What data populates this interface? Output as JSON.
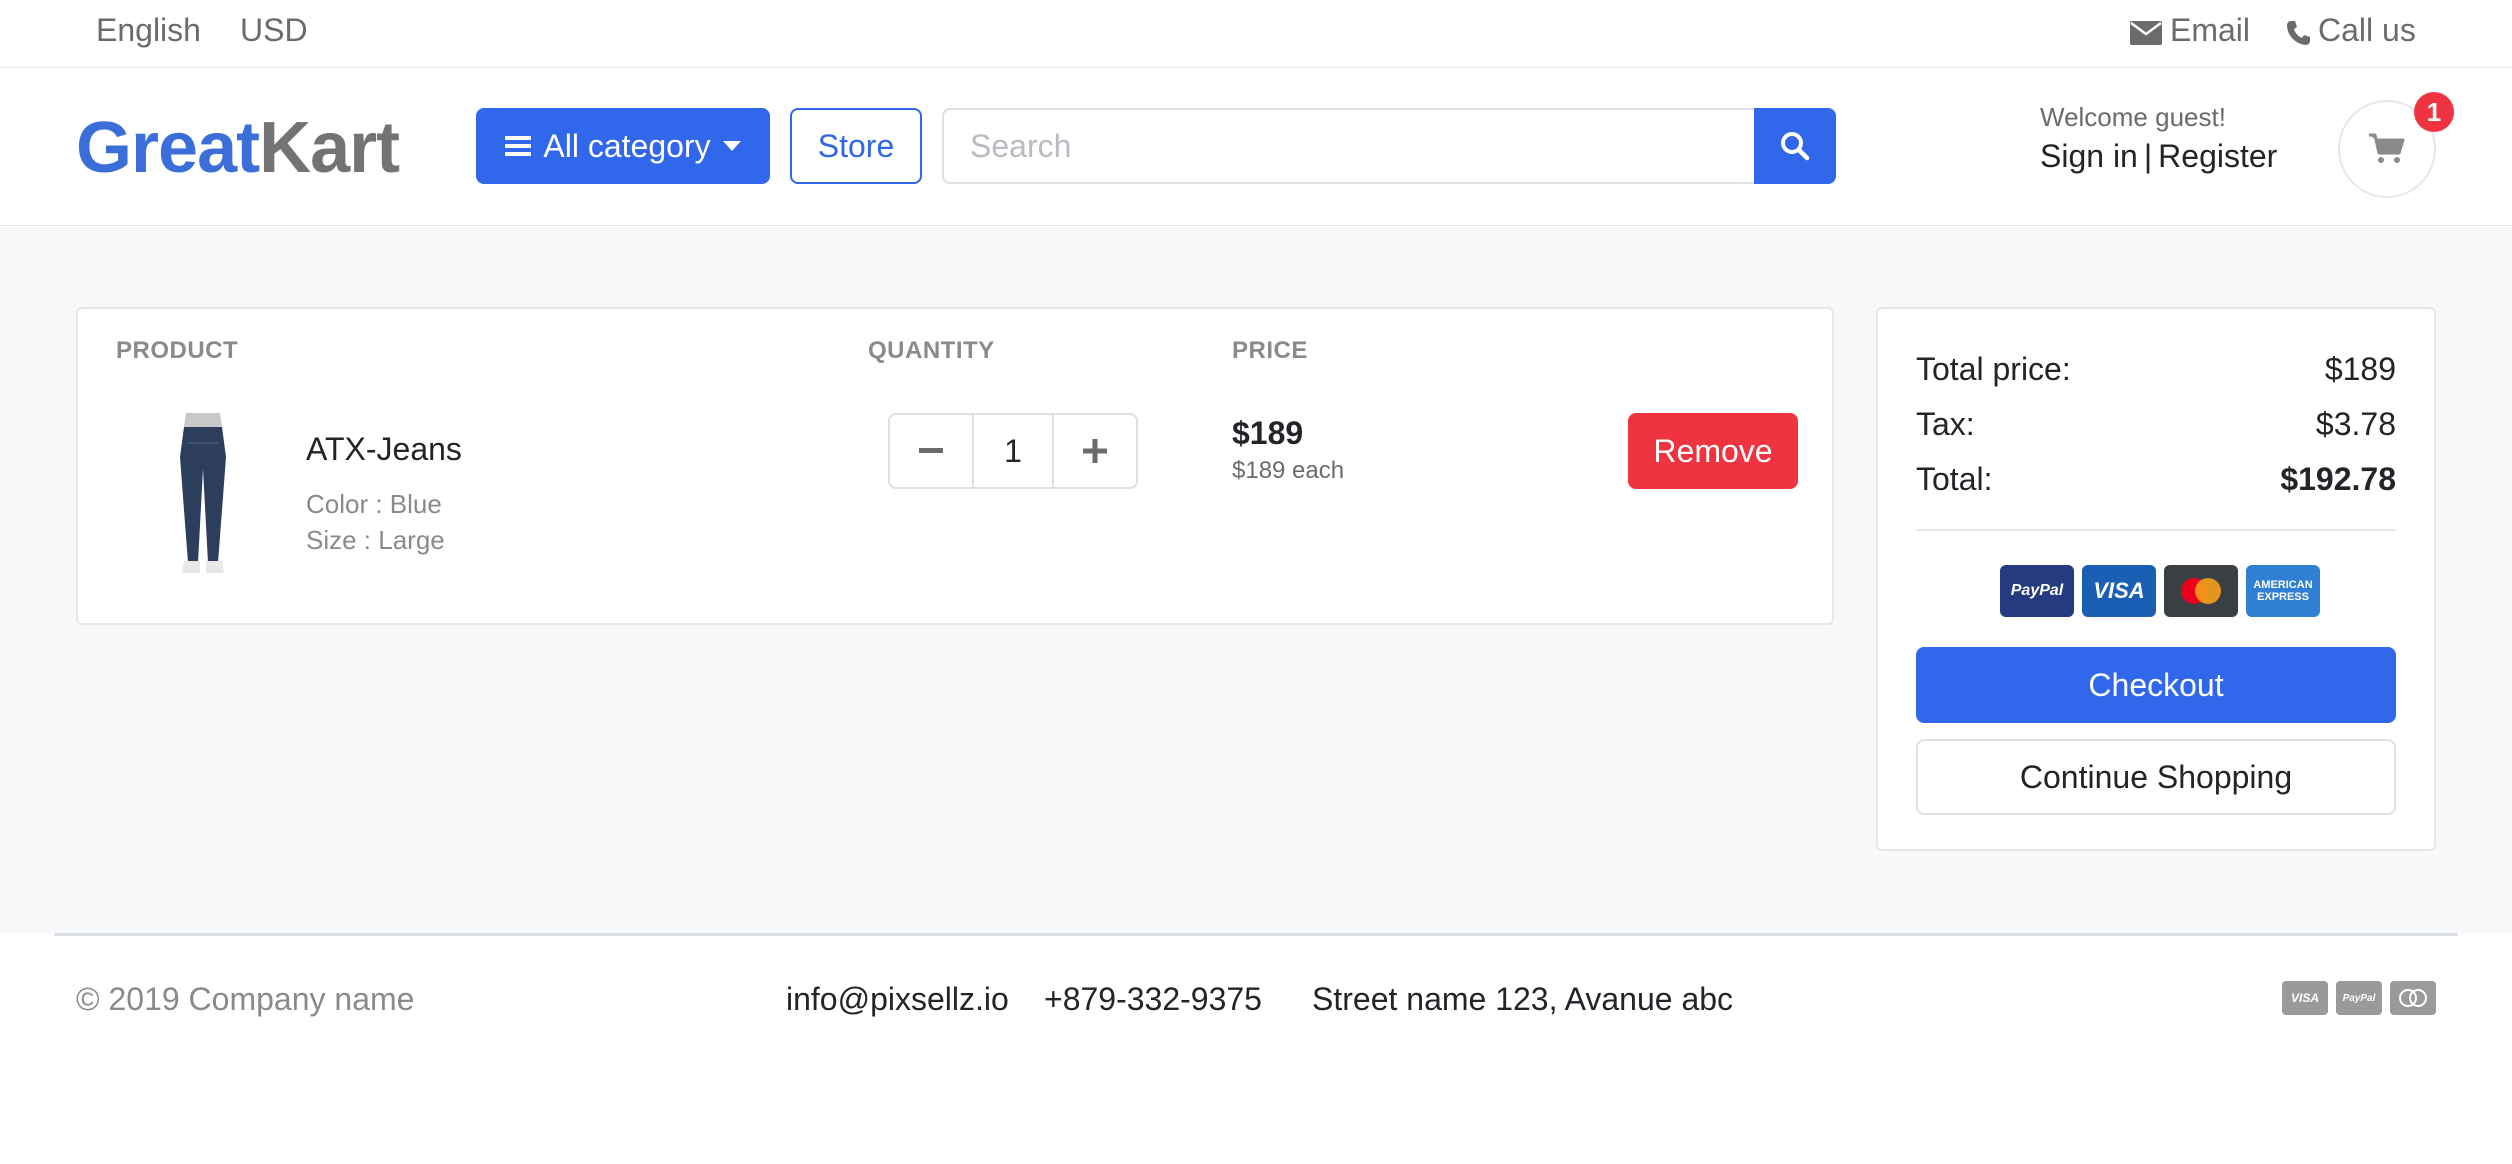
{
  "topbar": {
    "language": "English",
    "currency": "USD",
    "email_label": "Email",
    "call_label": "Call us"
  },
  "header": {
    "logo_part1": "Great",
    "logo_part2": "Kart",
    "category_label": "All category",
    "store_label": "Store",
    "search_placeholder": "Search",
    "welcome": "Welcome guest!",
    "sign_in": "Sign in",
    "separator": "|",
    "register": "Register",
    "cart_count": "1"
  },
  "cart": {
    "columns": {
      "product": "PRODUCT",
      "quantity": "QUANTITY",
      "price": "PRICE"
    },
    "items": [
      {
        "name": "ATX-Jeans",
        "color": "Color : Blue",
        "size": "Size : Large",
        "quantity": "1",
        "price": "$189",
        "price_each": "$189 each",
        "remove_label": "Remove"
      }
    ]
  },
  "summary": {
    "total_price_label": "Total price:",
    "total_price_value": "$189",
    "tax_label": "Tax:",
    "tax_value": "$3.78",
    "total_label": "Total:",
    "total_value": "$192.78",
    "payment_methods": [
      "PayPal",
      "VISA",
      "MasterCard",
      "AMERICAN EXPRESS"
    ],
    "checkout_label": "Checkout",
    "continue_label": "Continue Shopping"
  },
  "footer": {
    "copyright": "© 2019 Company name",
    "email": "info@pixsellz.io",
    "phone": "+879-332-9375",
    "address": "Street name 123, Avanue abc",
    "payment_icons": [
      "VISA",
      "PayPal",
      "MasterCard"
    ]
  },
  "colors": {
    "primary": "#3167eb",
    "danger": "#ef3340",
    "logo_blue": "#3b6ed8",
    "logo_gray": "#737373",
    "muted": "#8a8a8a"
  }
}
